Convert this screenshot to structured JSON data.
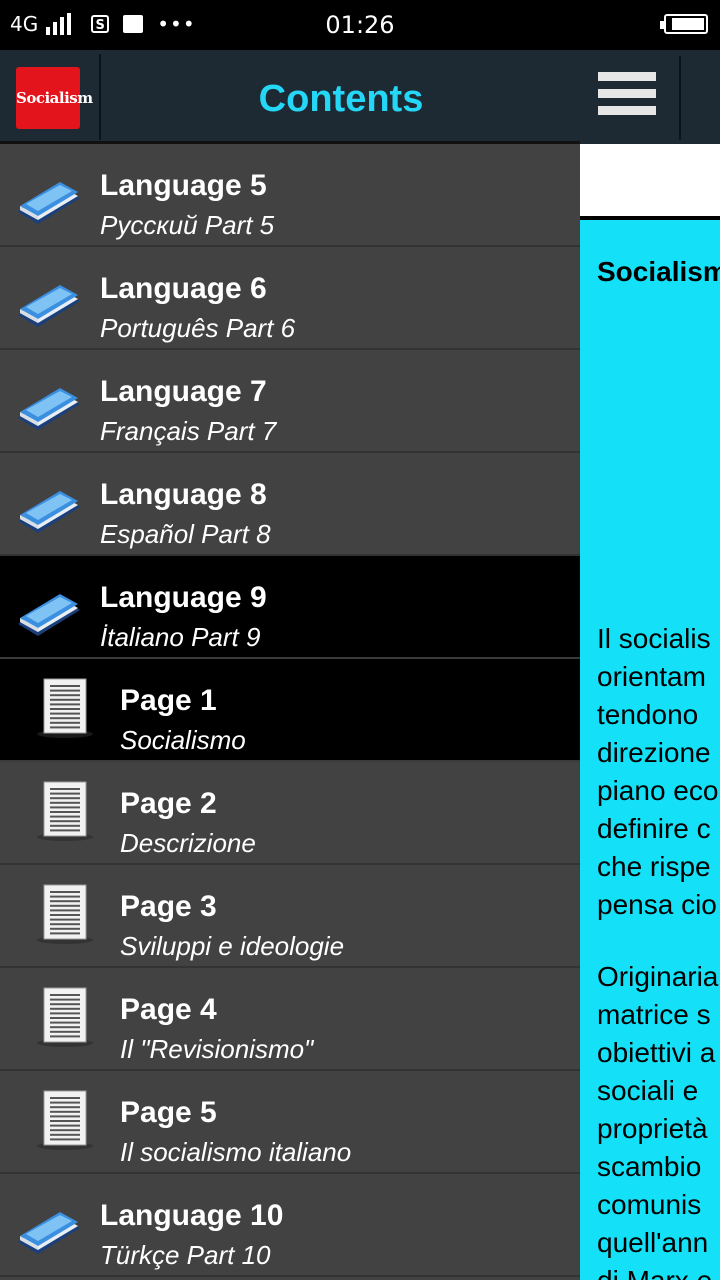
{
  "status_bar": {
    "network": "4G",
    "sim_icon": "S",
    "time": "01:26",
    "more": "•••"
  },
  "drawer": {
    "logo_text": "Socialism",
    "title": "Contents",
    "items": [
      {
        "kind": "language",
        "title": "Language 5",
        "subtitle": "Русский Part 5",
        "selected": false
      },
      {
        "kind": "language",
        "title": "Language 6",
        "subtitle": "Português Part 6",
        "selected": false
      },
      {
        "kind": "language",
        "title": "Language 7",
        "subtitle": "Français Part 7",
        "selected": false
      },
      {
        "kind": "language",
        "title": "Language 8",
        "subtitle": "Español Part 8",
        "selected": false
      },
      {
        "kind": "language",
        "title": "Language 9",
        "subtitle": "İtaliano Part 9",
        "selected": true
      },
      {
        "kind": "page",
        "title": "Page 1",
        "subtitle": "Socialismo",
        "selected": true
      },
      {
        "kind": "page",
        "title": "Page 2",
        "subtitle": "Descrizione",
        "selected": false
      },
      {
        "kind": "page",
        "title": "Page 3",
        "subtitle": "Sviluppi e ideologie",
        "selected": false
      },
      {
        "kind": "page",
        "title": "Page 4",
        "subtitle": "Il \"Revisionismo\"",
        "selected": false
      },
      {
        "kind": "page",
        "title": "Page 5",
        "subtitle": "Il socialismo italiano",
        "selected": false
      },
      {
        "kind": "language",
        "title": "Language 10",
        "subtitle": "Türkçe Part 10",
        "selected": false
      }
    ]
  },
  "content": {
    "article_title": "Socialism",
    "paragraph_1": [
      "Il socialis",
      "orientam",
      "tendono",
      "direzione",
      "piano eco",
      "definire c",
      "che rispe",
      "pensa cio"
    ],
    "paragraph_2": [
      "Originaria",
      "matrice s",
      "obiettivi a",
      "sociali e",
      "proprietà",
      "scambio",
      "comunis",
      "quell'ann",
      "di Marx e"
    ]
  },
  "colors": {
    "accent": "#24d7f7",
    "content_bg": "#14e1f8",
    "drawer_bg": "#424242",
    "header_bg": "#1e2a33"
  }
}
